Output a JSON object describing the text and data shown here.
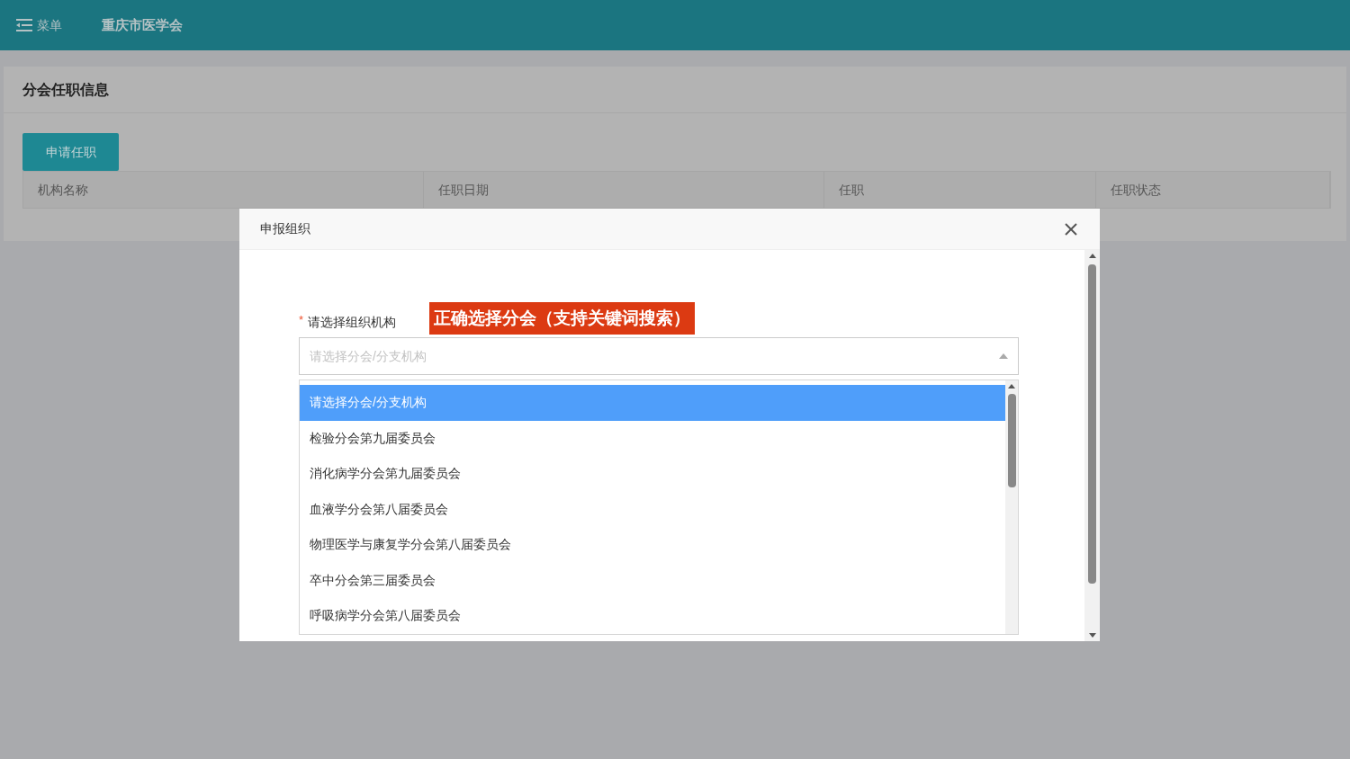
{
  "header": {
    "menu_label": "菜单",
    "title": "重庆市医学会"
  },
  "card": {
    "title": "分会任职信息",
    "apply_button": "申请任职",
    "table": {
      "columns": [
        "机构名称",
        "任职日期",
        "任职",
        "任职状态"
      ]
    }
  },
  "dialog": {
    "title": "申报组织",
    "field": {
      "label": "请选择组织机构",
      "required_mark": "*",
      "annotation": "正确选择分会（支持关键词搜索）",
      "placeholder": "请选择分会/分支机构",
      "expanded": true,
      "options": [
        {
          "label": "请选择分会/分支机构",
          "selected": true
        },
        {
          "label": "检验分会第九届委员会",
          "selected": false
        },
        {
          "label": "消化病学分会第九届委员会",
          "selected": false
        },
        {
          "label": "血液学分会第八届委员会",
          "selected": false
        },
        {
          "label": "物理医学与康复学分会第八届委员会",
          "selected": false
        },
        {
          "label": "卒中分会第三届委员会",
          "selected": false
        },
        {
          "label": "呼吸病学分会第八届委员会",
          "selected": false
        }
      ]
    }
  }
}
